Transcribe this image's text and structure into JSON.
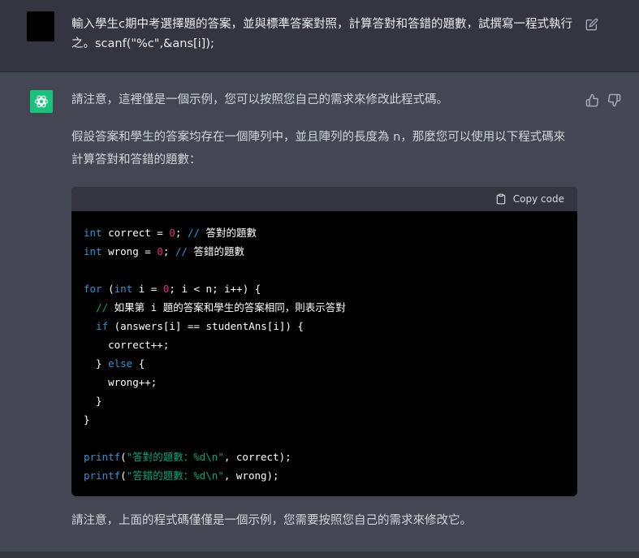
{
  "user_message": {
    "text": "輸入學生c期中考選擇題的答案，並與標準答案對照，計算答對和答錯的題數，試撰寫一程式執行之。scanf(\"%c\",&ans[i]);"
  },
  "assistant_message": {
    "intro": "請注意，這裡僅是一個示例，您可以按照您自己的需求來修改此程式碼。",
    "para2": "假設答案和學生的答案均存在一個陣列中，並且陣列的長度為 n，那麼您可以使用以下程式碼來計算答對和答錯的題數：",
    "outro": "請注意，上面的程式碼僅僅是一個示例，您需要按照您自己的需求來修改它。"
  },
  "code_block": {
    "copy_label": "Copy code",
    "lines": {
      "l1_kw": "int",
      "l1_rest": " correct = ",
      "l1_num": "0",
      "l1_semi": "; ",
      "l1_cm": "//",
      "l1_cmt": " 答對的題數",
      "l2_kw": "int",
      "l2_rest": " wrong = ",
      "l2_num": "0",
      "l2_semi": "; ",
      "l2_cm": "//",
      "l2_cmt": " 答錯的題數",
      "l4_kw": "for",
      "l4_a": " (",
      "l4_kw2": "int",
      "l4_b": " i = ",
      "l4_num": "0",
      "l4_c": "; i < n; i++) {",
      "l5_indent": "  ",
      "l5_cm": "//",
      "l5_cmt": " 如果第 i 題的答案和學生的答案相同，則表示答對",
      "l6_indent": "  ",
      "l6_kw": "if",
      "l6_rest": " (answers[i] == studentAns[i]) {",
      "l7": "    correct++;",
      "l8_a": "  } ",
      "l8_kw": "else",
      "l8_b": " {",
      "l9": "    wrong++;",
      "l10": "  }",
      "l11": "}",
      "l13_fn": "printf",
      "l13_a": "(",
      "l13_str": "\"答對的題數：%d\\n\"",
      "l13_b": ", correct);",
      "l14_fn": "printf",
      "l14_a": "(",
      "l14_str": "\"答錯的題數：%d\\n\"",
      "l14_b": ", wrong);"
    }
  },
  "colors": {
    "assistant_avatar": "#19c37d",
    "user_bg": "#343541",
    "assistant_bg": "#444654"
  },
  "icons": {
    "edit": "edit-icon",
    "thumb_up": "thumbs-up-icon",
    "thumb_down": "thumbs-down-icon",
    "copy": "clipboard-icon",
    "assistant_logo": "openai-logo-icon"
  }
}
